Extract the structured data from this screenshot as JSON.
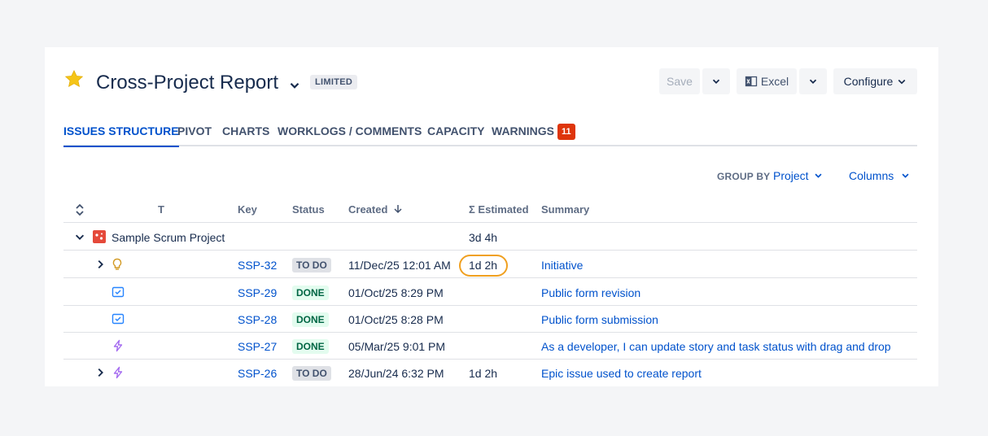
{
  "header": {
    "title": "Cross-Project Report",
    "badge": "LIMITED",
    "save_label": "Save",
    "excel_label": "Excel",
    "configure_label": "Configure"
  },
  "tabs": [
    {
      "label": "ISSUES STRUCTURE",
      "active": true
    },
    {
      "label": "PIVOT"
    },
    {
      "label": "CHARTS"
    },
    {
      "label": "WORKLOGS / COMMENTS"
    },
    {
      "label": "CAPACITY"
    },
    {
      "label": "WARNINGS",
      "count": "11"
    }
  ],
  "toolbar": {
    "group_by_label": "GROUP BY",
    "group_by_value": "Project",
    "columns_label": "Columns"
  },
  "table": {
    "columns": [
      "T",
      "Key",
      "Status",
      "Created",
      "Σ Estimated",
      "Summary"
    ],
    "group": {
      "name": "Sample Scrum Project",
      "estimated": "3d 4h"
    },
    "rows": [
      {
        "key": "SSP-32",
        "status": "TO DO",
        "created": "11/Dec/25 12:01 AM",
        "estimated": "1d 2h",
        "summary": "Initiative",
        "type_icon": "lightbulb-icon",
        "expandable": true
      },
      {
        "key": "SSP-29",
        "status": "DONE",
        "created": "01/Oct/25 8:29 PM",
        "estimated": "",
        "summary": "Public form revision",
        "type_icon": "task-checkbox-icon"
      },
      {
        "key": "SSP-28",
        "status": "DONE",
        "created": "01/Oct/25 8:28 PM",
        "estimated": "",
        "summary": "Public form submission",
        "type_icon": "task-checkbox-icon"
      },
      {
        "key": "SSP-27",
        "status": "DONE",
        "created": "05/Mar/25 9:01 PM",
        "estimated": "",
        "summary": "As a developer, I can update story and task status with drag and drop",
        "type_icon": "epic-lightning-icon"
      },
      {
        "key": "SSP-26",
        "status": "TO DO",
        "created": "28/Jun/24 6:32 PM",
        "estimated": "1d 2h",
        "summary": "Epic issue used to create report",
        "type_icon": "epic-lightning-icon",
        "expandable": true
      }
    ]
  },
  "colors": {
    "accent": "#0052cc",
    "warning": "#de350b",
    "highlight": "#f0a020",
    "star": "#f5c518"
  }
}
